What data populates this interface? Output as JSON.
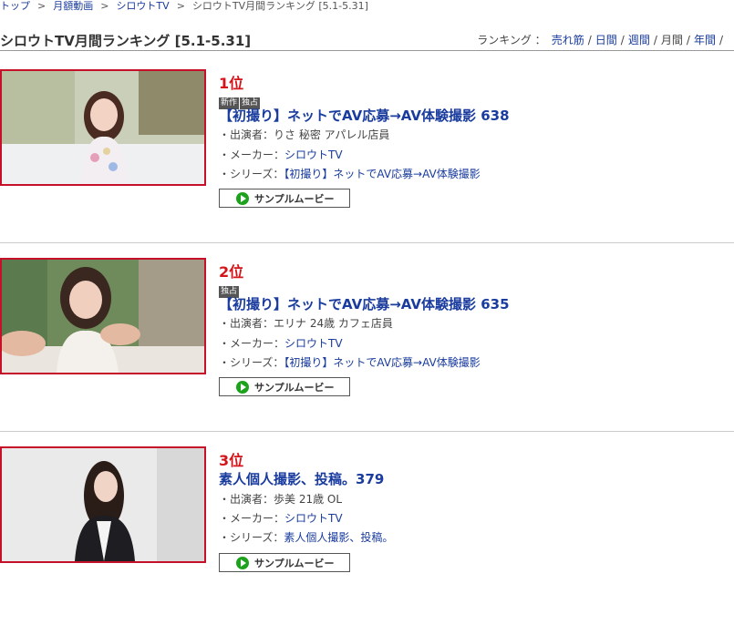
{
  "breadcrumb": {
    "items": [
      "トップ",
      "月額動画",
      "シロウトTV"
    ],
    "current": "シロウトTV月間ランキング [5.1-5.31]",
    "separator": ">"
  },
  "header": {
    "title": "シロウトTV月間ランキング [5.1-5.31]",
    "nav_label": "ランキング ：",
    "nav_items": [
      "売れ筋",
      "日間",
      "週間",
      "月間",
      "年間"
    ]
  },
  "labels": {
    "performer": "・出演者：",
    "maker": "・メーカー：",
    "series": "・シリーズ：",
    "sample_button": "サンプルムービー"
  },
  "entries": [
    {
      "rank": "1位",
      "badges": [
        "新作",
        "独占"
      ],
      "title": "【初撮り】ネットでAV応募→AV体験撮影 638",
      "performer": "りさ 秘密 アパレル店員",
      "maker": "シロウトTV",
      "series": "【初撮り】ネットでAV応募→AV体験撮影"
    },
    {
      "rank": "2位",
      "badges": [
        "独占"
      ],
      "title": "【初撮り】ネットでAV応募→AV体験撮影 635",
      "performer": "エリナ 24歳 カフェ店員",
      "maker": "シロウトTV",
      "series": "【初撮り】ネットでAV応募→AV体験撮影"
    },
    {
      "rank": "3位",
      "badges": [],
      "title": "素人個人撮影、投稿。379",
      "performer": "歩美 21歳 OL",
      "maker": "シロウトTV",
      "series": "素人個人撮影、投稿。"
    }
  ],
  "colors": {
    "rank": "#d4141a",
    "link": "#1a3c9e",
    "thumb_border": "#c6102a",
    "play": "#1da21d"
  }
}
